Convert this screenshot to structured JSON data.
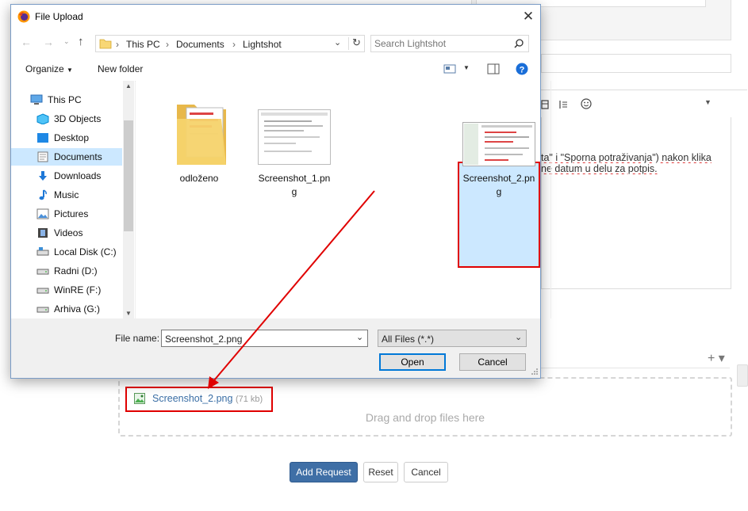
{
  "background_page": {
    "editor_text_line1": "ta\" i \"Sporna potraživanja\") nakon klika",
    "editor_text_line2": "ne datum u delu za potpis.",
    "dropzone_text": "Drag and drop files here",
    "uploaded_file": {
      "name": "Screenshot_2.png",
      "size": "(71 kb)"
    },
    "buttons": {
      "add_request": "Add Request",
      "reset": "Reset",
      "cancel": "Cancel"
    },
    "plus_label": "+ ▾"
  },
  "dialog": {
    "title": "File Upload",
    "address": {
      "crumbs": [
        "This PC",
        "Documents",
        "Lightshot"
      ]
    },
    "search_placeholder": "Search Lightshot",
    "commands": {
      "organize": "Organize",
      "new_folder": "New folder"
    },
    "nav_items": [
      {
        "label": "This PC",
        "icon": "computer-icon"
      },
      {
        "label": "3D Objects",
        "icon": "cube-icon"
      },
      {
        "label": "Desktop",
        "icon": "desktop-icon"
      },
      {
        "label": "Documents",
        "icon": "documents-icon",
        "selected": true
      },
      {
        "label": "Downloads",
        "icon": "download-arrow-icon"
      },
      {
        "label": "Music",
        "icon": "music-note-icon"
      },
      {
        "label": "Pictures",
        "icon": "pictures-icon"
      },
      {
        "label": "Videos",
        "icon": "film-icon"
      },
      {
        "label": "Local Disk (C:)",
        "icon": "drive-icon"
      },
      {
        "label": "Radni (D:)",
        "icon": "drive-icon"
      },
      {
        "label": "WinRE (F:)",
        "icon": "drive-icon"
      },
      {
        "label": "Arhiva (G:)",
        "icon": "drive-icon"
      }
    ],
    "files": [
      {
        "line1": "odloženo",
        "line2": "",
        "type": "folder"
      },
      {
        "line1": "Screenshot_1.pn",
        "line2": "g",
        "type": "image"
      },
      {
        "line1": "Screenshot_2.pn",
        "line2": "g",
        "type": "image",
        "selected": true
      }
    ],
    "file_name_label": "File name:",
    "file_name_value": "Screenshot_2.png",
    "file_type_value": "All Files (*.*)",
    "open_label": "Open",
    "cancel_label": "Cancel"
  },
  "colors": {
    "highlight_red": "#e00000",
    "selection_blue": "#cce8ff",
    "primary_button": "#3f6fa6"
  }
}
